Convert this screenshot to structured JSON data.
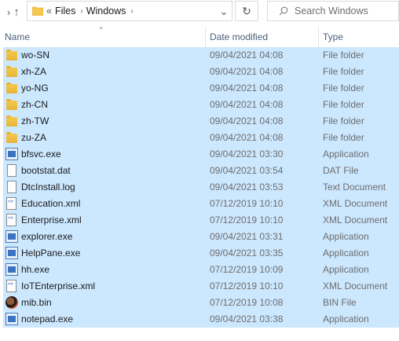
{
  "breadcrumb": {
    "overflow": "«",
    "parts": [
      "Files",
      "Windows"
    ]
  },
  "search": {
    "placeholder": "Search Windows"
  },
  "columns": {
    "name": "Name",
    "date": "Date modified",
    "type": "Type"
  },
  "rows": [
    {
      "name": "wo-SN",
      "date": "09/04/2021 04:08",
      "type": "File folder",
      "icon": "folder-icon"
    },
    {
      "name": "xh-ZA",
      "date": "09/04/2021 04:08",
      "type": "File folder",
      "icon": "folder-icon"
    },
    {
      "name": "yo-NG",
      "date": "09/04/2021 04:08",
      "type": "File folder",
      "icon": "folder-icon"
    },
    {
      "name": "zh-CN",
      "date": "09/04/2021 04:08",
      "type": "File folder",
      "icon": "folder-icon"
    },
    {
      "name": "zh-TW",
      "date": "09/04/2021 04:08",
      "type": "File folder",
      "icon": "folder-icon"
    },
    {
      "name": "zu-ZA",
      "date": "09/04/2021 04:08",
      "type": "File folder",
      "icon": "folder-icon"
    },
    {
      "name": "bfsvc.exe",
      "date": "09/04/2021 03:30",
      "type": "Application",
      "icon": "application-icon"
    },
    {
      "name": "bootstat.dat",
      "date": "09/04/2021 03:54",
      "type": "DAT File",
      "icon": "document-icon"
    },
    {
      "name": "DtcInstall.log",
      "date": "09/04/2021 03:53",
      "type": "Text Document",
      "icon": "document-icon"
    },
    {
      "name": "Education.xml",
      "date": "07/12/2019 10:10",
      "type": "XML Document",
      "icon": "xml-icon"
    },
    {
      "name": "Enterprise.xml",
      "date": "07/12/2019 10:10",
      "type": "XML Document",
      "icon": "xml-icon"
    },
    {
      "name": "explorer.exe",
      "date": "09/04/2021 03:31",
      "type": "Application",
      "icon": "application-icon"
    },
    {
      "name": "HelpPane.exe",
      "date": "09/04/2021 03:35",
      "type": "Application",
      "icon": "application-icon"
    },
    {
      "name": "hh.exe",
      "date": "07/12/2019 10:09",
      "type": "Application",
      "icon": "application-icon"
    },
    {
      "name": "IoTEnterprise.xml",
      "date": "07/12/2019 10:10",
      "type": "XML Document",
      "icon": "xml-icon"
    },
    {
      "name": "mib.bin",
      "date": "07/12/2019 10:08",
      "type": "BIN File",
      "icon": "image-icon"
    },
    {
      "name": "notepad.exe",
      "date": "09/04/2021 03:38",
      "type": "Application",
      "icon": "application-icon"
    }
  ],
  "colors": {
    "selection": "#cce8ff",
    "header_text": "#4c607a",
    "folder": "#f5c84f"
  }
}
